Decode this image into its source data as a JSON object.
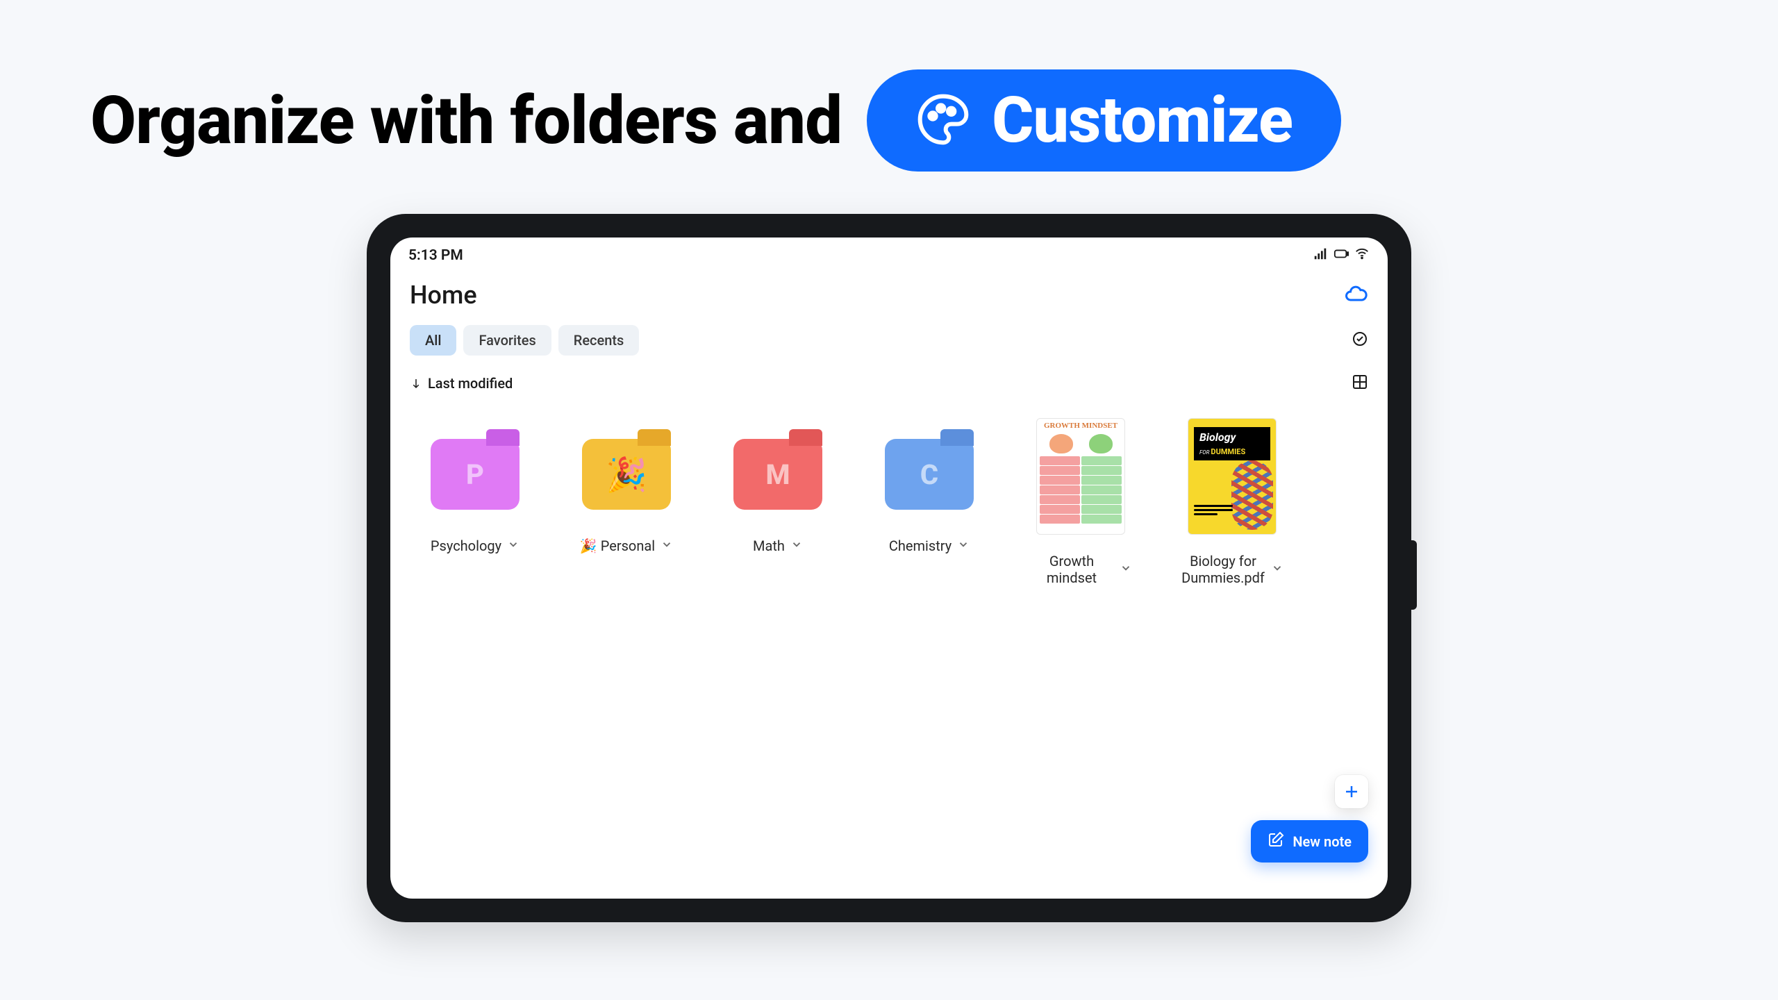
{
  "headline": {
    "text": "Organize with folders and",
    "pill_label": "Customize"
  },
  "status_bar": {
    "time": "5:13 PM"
  },
  "page": {
    "title": "Home"
  },
  "tabs": [
    {
      "label": "All",
      "active": true
    },
    {
      "label": "Favorites",
      "active": false
    },
    {
      "label": "Recents",
      "active": false
    }
  ],
  "sort": {
    "label": "Last modified"
  },
  "items": [
    {
      "type": "folder",
      "label": "Psychology",
      "letter": "P",
      "color": "pink"
    },
    {
      "type": "folder",
      "label": "🎉 Personal",
      "emoji": "🎉",
      "color": "yellow"
    },
    {
      "type": "folder",
      "label": "Math",
      "letter": "M",
      "color": "red"
    },
    {
      "type": "folder",
      "label": "Chemistry",
      "letter": "C",
      "color": "blue"
    },
    {
      "type": "doc",
      "label": "Growth mindset",
      "thumb": "growth",
      "thumb_title": "GROWTH MINDSET"
    },
    {
      "type": "doc",
      "label": "Biology for Dummies.pdf",
      "thumb": "biology",
      "thumb_title": "Biology",
      "thumb_sub": "DUMMIES",
      "thumb_for": "FOR"
    }
  ],
  "actions": {
    "new_note": "New note"
  }
}
